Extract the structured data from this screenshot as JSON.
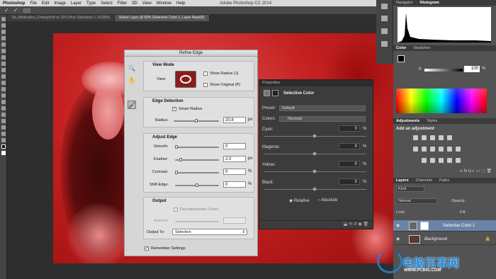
{
  "menubar": {
    "items": [
      "Photoshop",
      "File",
      "Edit",
      "Image",
      "Layer",
      "Type",
      "Select",
      "Filter",
      "3D",
      "View",
      "Window",
      "Help"
    ],
    "app_title": "Adobe Photoshop CC 2014"
  },
  "tabs": [
    {
      "label": "Tip_Multicolors_Changed.tif at 13% (Hue Saturation 1, RGB/8)"
    },
    {
      "label": "Select Layer @ 50% (Selective Color 1, Layer Mask/8)"
    }
  ],
  "refine_edge": {
    "title": "Refine Edge",
    "view_mode": {
      "heading": "View Mode",
      "view_label": "View:",
      "show_radius": "Show Radius (J)",
      "show_original": "Show Original (P)"
    },
    "edge_detection": {
      "heading": "Edge Detection",
      "smart_radius": "Smart Radius",
      "radius_label": "Radius:",
      "radius_value": "20.8",
      "radius_unit": "px"
    },
    "adjust_edge": {
      "heading": "Adjust Edge",
      "smooth_label": "Smooth:",
      "smooth_value": "0",
      "feather_label": "Feather:",
      "feather_value": "2.0",
      "feather_unit": "px",
      "contrast_label": "Contrast:",
      "contrast_value": "0",
      "contrast_unit": "%",
      "shift_label": "Shift Edge:",
      "shift_value": "0",
      "shift_unit": "%"
    },
    "output": {
      "heading": "Output",
      "decontaminate": "Decontaminate Colors",
      "amount_label": "Amount:",
      "output_to_label": "Output To:",
      "output_to_value": "Selection"
    },
    "remember": "Remember Settings"
  },
  "properties": {
    "tab": "Properties",
    "title": "Selective Color",
    "preset_label": "Preset:",
    "preset_value": "Default",
    "colors_label": "Colors:",
    "colors_value": "Neutrals",
    "cyan_label": "Cyan:",
    "cyan_value": "0",
    "magenta_label": "Magenta:",
    "magenta_value": "0",
    "yellow_label": "Yellow:",
    "yellow_value": "0",
    "black_label": "Black:",
    "black_value": "0",
    "pct": "%",
    "relative": "Relative",
    "absolute": "Absolute"
  },
  "right": {
    "navigator_tab": "Navigator",
    "histogram_tab": "Histogram",
    "color_tab": "Color",
    "swatches_tab": "Swatches",
    "k_label": "K",
    "k_value": "100",
    "k_unit": "%",
    "adjustments_tab": "Adjustments",
    "styles_tab": "Styles",
    "add_adjustment": "Add an adjustment",
    "layers_tab": "Layers",
    "channels_tab": "Channels",
    "paths_tab": "Paths",
    "kind": "Kind",
    "blend_mode": "Normal",
    "opacity_label": "Opacity:",
    "lock_label": "Lock:",
    "fill_label": "Fill:",
    "layers": [
      {
        "name": "Selective Color 1"
      },
      {
        "name": "Background"
      }
    ]
  },
  "watermark": {
    "text": "电脑百事网",
    "url": "WWW.PC841.COM"
  }
}
